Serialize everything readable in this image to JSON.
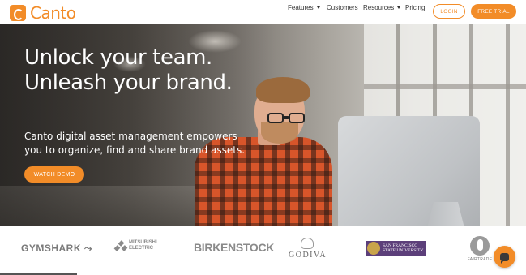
{
  "header": {
    "logo_text": "Canto",
    "nav": [
      {
        "label": "Features",
        "has_dropdown": true
      },
      {
        "label": "Customers",
        "has_dropdown": false
      },
      {
        "label": "Resources",
        "has_dropdown": true
      },
      {
        "label": "Pricing",
        "has_dropdown": false
      }
    ],
    "login_label": "LOGIN",
    "trial_label": "FREE TRIAL"
  },
  "hero": {
    "title_line1": "Unlock your team.",
    "title_line2": "Unleash your brand.",
    "subtitle": "Canto digital asset management empowers you to organize, find and share brand assets.",
    "cta_label": "WATCH DEMO"
  },
  "logos": {
    "gymshark": "GYMSHARK",
    "mitsubishi_line1": "MITSUBISHI",
    "mitsubishi_line2": "ELECTRIC",
    "birkenstock": "BIRKENSTOCK",
    "godiva": "GODIVA",
    "sfsu_line1": "SAN FRANCISCO",
    "sfsu_line2": "STATE UNIVERSITY",
    "fairtrade": "FAIRTRADE"
  },
  "colors": {
    "accent": "#f28c28",
    "text_dark": "#333333",
    "hero_text": "#ffffff"
  },
  "icons": {
    "logo": "canto-logo-icon",
    "chat": "chat-icon",
    "dropdown": "chevron-down-icon"
  }
}
